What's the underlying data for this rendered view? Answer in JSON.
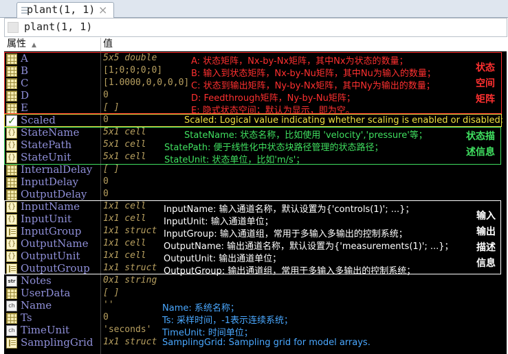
{
  "tab": {
    "label": "plant(1, 1)",
    "close": "×"
  },
  "address": {
    "text": "plant(1, 1)"
  },
  "headers": {
    "property": "属性",
    "value": "值",
    "sort_glyph": "▲"
  },
  "rows": [
    {
      "name": "A",
      "value": "5x5 double",
      "icon": "matrix-icon",
      "annotation": "A: 状态矩阵，Nx-by-Nx矩阵，其中Nx为状态的数量；"
    },
    {
      "name": "B",
      "value": "[1;0;0;0;0]",
      "icon": "matrix-icon",
      "annotation": "B: 输入到状态矩阵，Nx-by-Nu矩阵，其中Nu为输入的数量；"
    },
    {
      "name": "C",
      "value": "[1.0000,0,0,0,0]",
      "icon": "matrix-icon",
      "annotation": "C: 状态到输出矩阵，Ny-by-Nx矩阵，其中Ny为输出的数量；"
    },
    {
      "name": "D",
      "value": "0",
      "icon": "matrix-icon",
      "annotation": "D: Feedthrough矩阵，Ny-by-Nu矩阵；"
    },
    {
      "name": "E",
      "value": "[ ]",
      "icon": "matrix-icon",
      "annotation": "E: 隐式状态空间；默认为显示，即为空。"
    },
    {
      "name": "Scaled",
      "value": "0",
      "icon": "checkbox-icon",
      "annotation": "Scaled: Logical value indicating whether scaling is enabled or disabled;"
    },
    {
      "name": "StateName",
      "value": "5x1 cell",
      "icon": "cell-array-icon",
      "annotation": "StateName: 状态名称，比如使用 'velocity','pressure'等；"
    },
    {
      "name": "StatePath",
      "value": "5x1 cell",
      "icon": "cell-array-icon",
      "annotation": "StatePath: 便于线性化中状态块路径管理的状态路径；"
    },
    {
      "name": "StateUnit",
      "value": "5x1 cell",
      "icon": "cell-array-icon",
      "annotation": "StateUnit: 状态单位，比如'm/s'；"
    },
    {
      "name": "InternalDelay",
      "value": "[ ]",
      "icon": "matrix-icon",
      "annotation": ""
    },
    {
      "name": "InputDelay",
      "value": "0",
      "icon": "matrix-icon",
      "annotation": ""
    },
    {
      "name": "OutputDelay",
      "value": "0",
      "icon": "matrix-icon",
      "annotation": ""
    },
    {
      "name": "InputName",
      "value": "1x1 cell",
      "icon": "cell-array-icon",
      "annotation": "InputName: 输入通道名称，默认设置为{'controls(1)'; ...}；"
    },
    {
      "name": "InputUnit",
      "value": "1x1 cell",
      "icon": "cell-array-icon",
      "annotation": "InputUnit: 输入通道单位；"
    },
    {
      "name": "InputGroup",
      "value": "1x1 struct",
      "icon": "struct-icon",
      "annotation": "InputGroup: 输入通道组，常用于多输入多输出的控制系统；"
    },
    {
      "name": "OutputName",
      "value": "1x1 cell",
      "icon": "cell-array-icon",
      "annotation": "OutputName: 输出通道名称，默认设置为{'measurements(1)'; ...}；"
    },
    {
      "name": "OutputUnit",
      "value": "1x1 cell",
      "icon": "cell-array-icon",
      "annotation": "OutputUnit: 输出通道单位；"
    },
    {
      "name": "OutputGroup",
      "value": "1x1 struct",
      "icon": "struct-icon",
      "annotation": "OutputGroup: 输出通道组，常用于多输入多输出的控制系统；"
    },
    {
      "name": "Notes",
      "value": "0x1 string",
      "icon": "string-icon",
      "annotation": ""
    },
    {
      "name": "UserData",
      "value": "[ ]",
      "icon": "matrix-icon",
      "annotation": ""
    },
    {
      "name": "Name",
      "value": "''",
      "icon": "char-icon",
      "annotation": "Name: 系统名称；"
    },
    {
      "name": "Ts",
      "value": "0",
      "icon": "matrix-icon",
      "annotation": "Ts: 采样时间，-1表示连续系统；"
    },
    {
      "name": "TimeUnit",
      "value": "'seconds'",
      "icon": "char-icon",
      "annotation": "TimeUnit: 时间单位；"
    },
    {
      "name": "SamplingGrid",
      "value": "1x1 struct",
      "icon": "struct-icon",
      "annotation": "SamplingGrid: Sampling grid for model arrays."
    }
  ],
  "side_labels": {
    "matrix": [
      "状态",
      "空间",
      "矩阵"
    ],
    "state": [
      "状态描",
      "述信息"
    ],
    "io": [
      "输入",
      "输出",
      "描述",
      "信息"
    ]
  },
  "colors": {
    "matrix_group": "#ff3030",
    "scaled_note": "#f0e040",
    "state_group": "#40e060",
    "io_group": "#ffffff",
    "misc_notes": "#4aa8ff",
    "property_name": "#8f8fd8",
    "value_text": "#b8a060"
  }
}
